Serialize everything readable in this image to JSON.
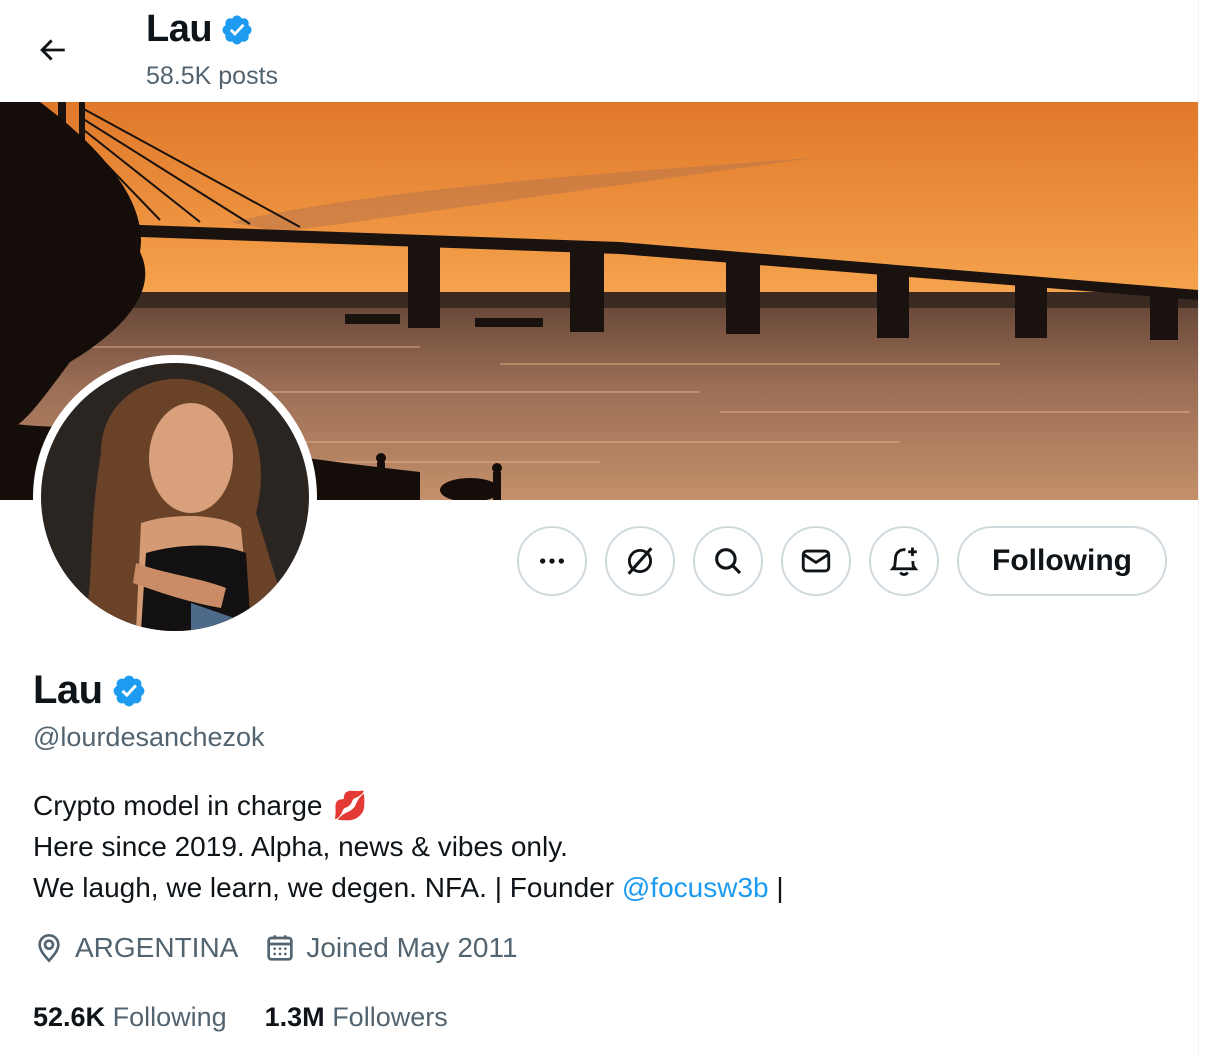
{
  "header": {
    "back_label": "Back",
    "name": "Lau",
    "posts": "58.5K posts"
  },
  "profile": {
    "name": "Lau",
    "handle": "@lourdesanchezok",
    "bio": {
      "line1": "Crypto model in charge",
      "line1_emoji": "💋",
      "line2": "Here since 2019. Alpha, news & vibes only.",
      "line3_prefix": "We laugh, we learn, we degen. NFA. | Founder ",
      "line3_mention": "@focusw3b",
      "line3_suffix": " |"
    },
    "location": "ARGENTINA",
    "joined": "Joined May 2011",
    "following_count": "52.6K",
    "following_label": "Following",
    "followers_count": "1.3M",
    "followers_label": "Followers"
  },
  "actions": {
    "more_icon": "more-icon",
    "grok_icon": "grok-icon",
    "search_icon": "search-icon",
    "message_icon": "mail-icon",
    "notify_icon": "bell-plus-icon",
    "follow_label": "Following"
  },
  "colors": {
    "accent": "#1d9bf0",
    "secondary_text": "#536471",
    "border": "#cfd9de"
  }
}
